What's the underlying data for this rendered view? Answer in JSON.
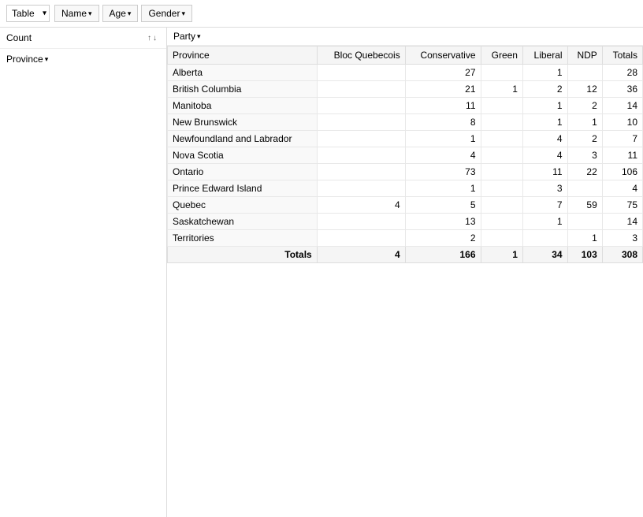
{
  "topBar": {
    "tableSelectValue": "Table",
    "filters": [
      {
        "label": "Name",
        "id": "name-filter"
      },
      {
        "label": "Age",
        "id": "age-filter"
      },
      {
        "label": "Gender",
        "id": "gender-filter"
      }
    ]
  },
  "leftPanel": {
    "countLabel": "Count",
    "provinceFilter": "Province"
  },
  "rightPanel": {
    "partyLabel": "Party",
    "table": {
      "columnHeaders": {
        "province": "Province",
        "party": "Party",
        "bloc": "Bloc Quebecois",
        "conservative": "Conservative",
        "green": "Green",
        "liberal": "Liberal",
        "ndp": "NDP",
        "totals": "Totals"
      },
      "rows": [
        {
          "province": "Alberta",
          "bloc": "",
          "conservative": 27,
          "green": "",
          "liberal": 1,
          "ndp": "",
          "totals": 28
        },
        {
          "province": "British Columbia",
          "bloc": "",
          "conservative": 21,
          "green": 1,
          "liberal": 2,
          "ndp": 12,
          "totals": 36
        },
        {
          "province": "Manitoba",
          "bloc": "",
          "conservative": 11,
          "green": "",
          "liberal": 1,
          "ndp": 2,
          "totals": 14
        },
        {
          "province": "New Brunswick",
          "bloc": "",
          "conservative": 8,
          "green": "",
          "liberal": 1,
          "ndp": 1,
          "totals": 10
        },
        {
          "province": "Newfoundland and Labrador",
          "bloc": "",
          "conservative": 1,
          "green": "",
          "liberal": 4,
          "ndp": 2,
          "totals": 7
        },
        {
          "province": "Nova Scotia",
          "bloc": "",
          "conservative": 4,
          "green": "",
          "liberal": 4,
          "ndp": 3,
          "totals": 11
        },
        {
          "province": "Ontario",
          "bloc": "",
          "conservative": 73,
          "green": "",
          "liberal": 11,
          "ndp": 22,
          "totals": 106
        },
        {
          "province": "Prince Edward Island",
          "bloc": "",
          "conservative": 1,
          "green": "",
          "liberal": 3,
          "ndp": "",
          "totals": 4
        },
        {
          "province": "Quebec",
          "bloc": 4,
          "conservative": 5,
          "green": "",
          "liberal": 7,
          "ndp": 59,
          "totals": 75
        },
        {
          "province": "Saskatchewan",
          "bloc": "",
          "conservative": 13,
          "green": "",
          "liberal": 1,
          "ndp": "",
          "totals": 14
        },
        {
          "province": "Territories",
          "bloc": "",
          "conservative": 2,
          "green": "",
          "liberal": "",
          "ndp": 1,
          "totals": 3
        }
      ],
      "totalsRow": {
        "label": "Totals",
        "bloc": 4,
        "conservative": 166,
        "green": 1,
        "liberal": 34,
        "ndp": 103,
        "totals": 308
      }
    }
  }
}
